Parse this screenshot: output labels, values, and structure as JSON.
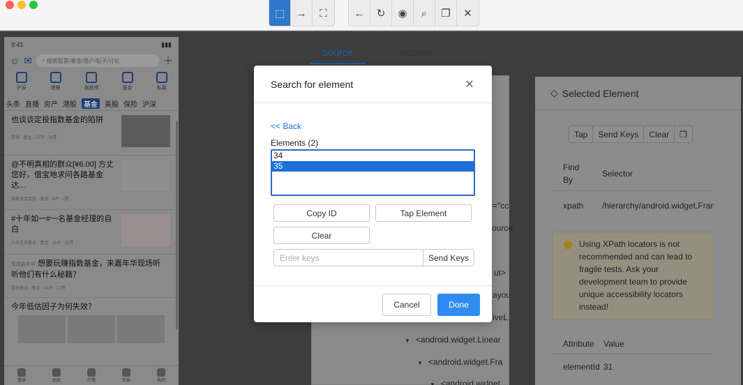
{
  "toolbar": {
    "group1": [
      {
        "name": "select-element-icon",
        "glyph": "⬚"
      },
      {
        "name": "swipe-icon",
        "glyph": "→"
      },
      {
        "name": "tap-coordinates-icon",
        "glyph": "⛶"
      }
    ],
    "group2": [
      {
        "name": "back-icon",
        "glyph": "←"
      },
      {
        "name": "refresh-icon",
        "glyph": "↻"
      },
      {
        "name": "eye-icon",
        "glyph": "◉"
      },
      {
        "name": "search-icon",
        "glyph": "⌕"
      },
      {
        "name": "copy-icon",
        "glyph": "❐"
      },
      {
        "name": "close-icon",
        "glyph": "✕"
      }
    ]
  },
  "phone": {
    "time": "9:41",
    "search_placeholder": "搜索股票/基金/用户/帖子/讨论",
    "quick": [
      "沪深",
      "港美",
      "涨跌榜",
      "基金",
      "私募"
    ],
    "tabs": [
      "头条",
      "直播",
      "房产",
      "港股",
      "基金",
      "美股",
      "保险",
      "沪深"
    ],
    "active_tab": "基金",
    "items": [
      {
        "title": "也谈谈定投指数基金的陷阱",
        "meta": "雪球 · 基金 · 15评 · 76赞"
      },
      {
        "title": "@不明真相的群众[¥6.00] 方丈您好，借宝地求问各路基金达...",
        "meta": "指数基金定投 · 基金 · 8评 · 1赞"
      },
      {
        "title": "#十年如一#一名基金经理的自白",
        "meta": "兴业全球基金 · 基金 · 26评 · 33赞"
      },
      {
        "title": "想要玩赚指数基金，来嘉年华现场听听他们有什么秘籍？",
        "meta": "雪球基金 · 基金 · 40评 · 12赞",
        "prefix": "雪球嘉年华"
      },
      {
        "title": "今年低估因子为何失效？",
        "meta": ""
      }
    ],
    "bottom": [
      "雪球",
      "动态",
      "行情",
      "交易",
      "我的"
    ]
  },
  "source_tabs": {
    "source": "Source",
    "actions": "Actions"
  },
  "tree": {
    "fragments": [
      "=\"cc",
      "ource",
      "ut>",
      "ayou",
      "iveL"
    ],
    "lines": [
      "<android.widget.Linear",
      "<android.widget.Fra",
      "<android.widget."
    ]
  },
  "selected": {
    "title": "Selected Element",
    "buttons": {
      "tap": "Tap",
      "send_keys": "Send Keys",
      "clear": "Clear"
    },
    "find_by_header": "Find By",
    "selector_header": "Selector",
    "find_by": "xpath",
    "selector": "/hierarchy/android.widget.FrameLa",
    "warning": "Using XPath locators is not recommended and can lead to fragile tests. Ask your development team to provide unique accessibility locators instead!",
    "attr_header": "Attribute",
    "value_header": "Value",
    "attr_name": "elementId",
    "attr_value": "31"
  },
  "modal": {
    "title": "Search for element",
    "back": "<< Back",
    "elements_label": "Elements (2)",
    "elements": [
      "34",
      "35"
    ],
    "selected_index": 1,
    "copy_id": "Copy ID",
    "tap_element": "Tap Element",
    "clear": "Clear",
    "keys_placeholder": "Enter keys",
    "send_keys": "Send Keys",
    "cancel": "Cancel",
    "done": "Done"
  }
}
